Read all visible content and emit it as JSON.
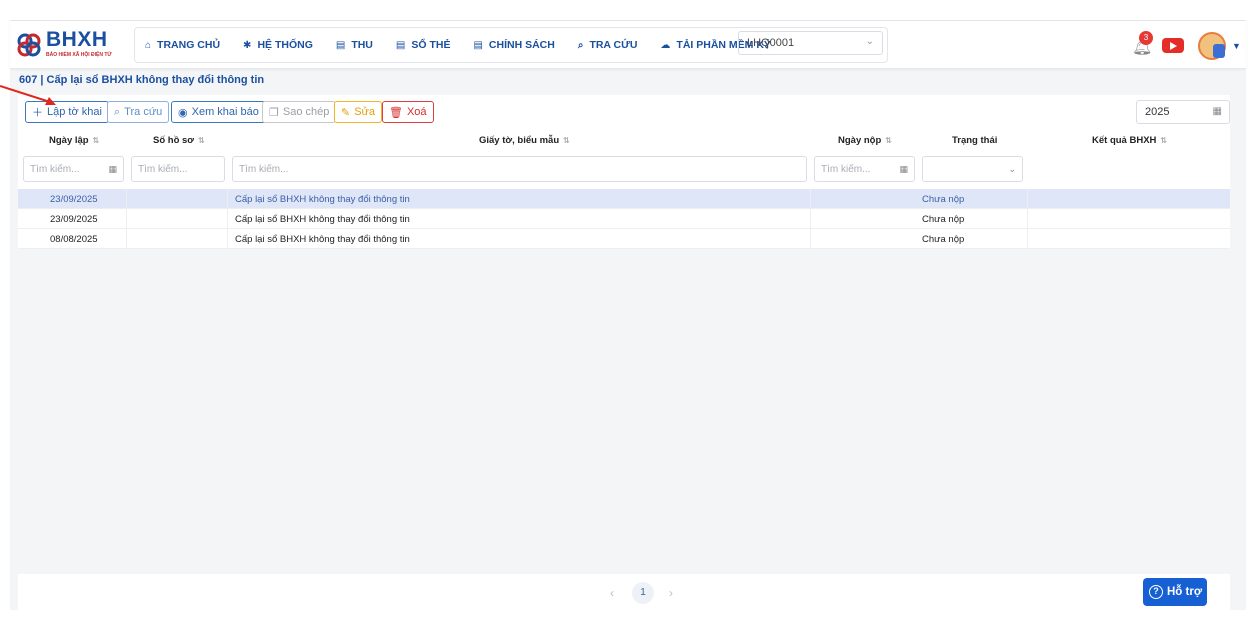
{
  "logo": {
    "name": "BHXH",
    "subtitle": "BẢO HIỂM XÃ HỘI ĐIỆN TỬ"
  },
  "nav": {
    "items": [
      {
        "label": "TRANG CHỦ",
        "icon": "home-icon"
      },
      {
        "label": "HỆ THỐNG",
        "icon": "gear-icon"
      },
      {
        "label": "THU",
        "icon": "document-icon"
      },
      {
        "label": "SỔ THẺ",
        "icon": "document-icon"
      },
      {
        "label": "CHÍNH SÁCH",
        "icon": "document-icon"
      },
      {
        "label": "TRA CỨU",
        "icon": "search-icon"
      },
      {
        "label": "TẢI PHẦN MỀM KÝ",
        "icon": "cloud-icon"
      }
    ],
    "unit_select": "LHQ0001"
  },
  "notifications": {
    "count": "3"
  },
  "breadcrumb": "607 | Cấp lại sổ BHXH không thay đổi thông tin",
  "toolbar": {
    "create_label": "Lập tờ khai",
    "search_label": "Tra cứu",
    "view_label": "Xem khai báo",
    "copy_label": "Sao chép",
    "edit_label": "Sửa",
    "delete_label": "Xoá",
    "year": "2025"
  },
  "table": {
    "headers": [
      "Ngày lập",
      "Số hồ sơ",
      "Giấy tờ, biểu mẫu",
      "Ngày nộp",
      "Trạng thái",
      "Kết quả BHXH"
    ],
    "filter_placeholder": "Tìm kiếm...",
    "rows": [
      {
        "date": "23/09/2025",
        "number": "",
        "form": "Cấp lại sổ BHXH không thay đổi thông tin",
        "submit_date": "",
        "status": "Chưa nộp",
        "result": ""
      },
      {
        "date": "23/09/2025",
        "number": "",
        "form": "Cấp lại sổ BHXH không thay đổi thông tin",
        "submit_date": "",
        "status": "Chưa nộp",
        "result": ""
      },
      {
        "date": "08/08/2025",
        "number": "",
        "form": "Cấp lại sổ BHXH không thay đổi thông tin",
        "submit_date": "",
        "status": "Chưa nộp",
        "result": ""
      }
    ]
  },
  "pagination": {
    "current": "1"
  },
  "help": {
    "label": "Hỗ trợ"
  },
  "colors": {
    "brand": "#1b4fa0",
    "accent": "#1660d4",
    "danger": "#d62c2c",
    "warning": "#e3a008"
  }
}
